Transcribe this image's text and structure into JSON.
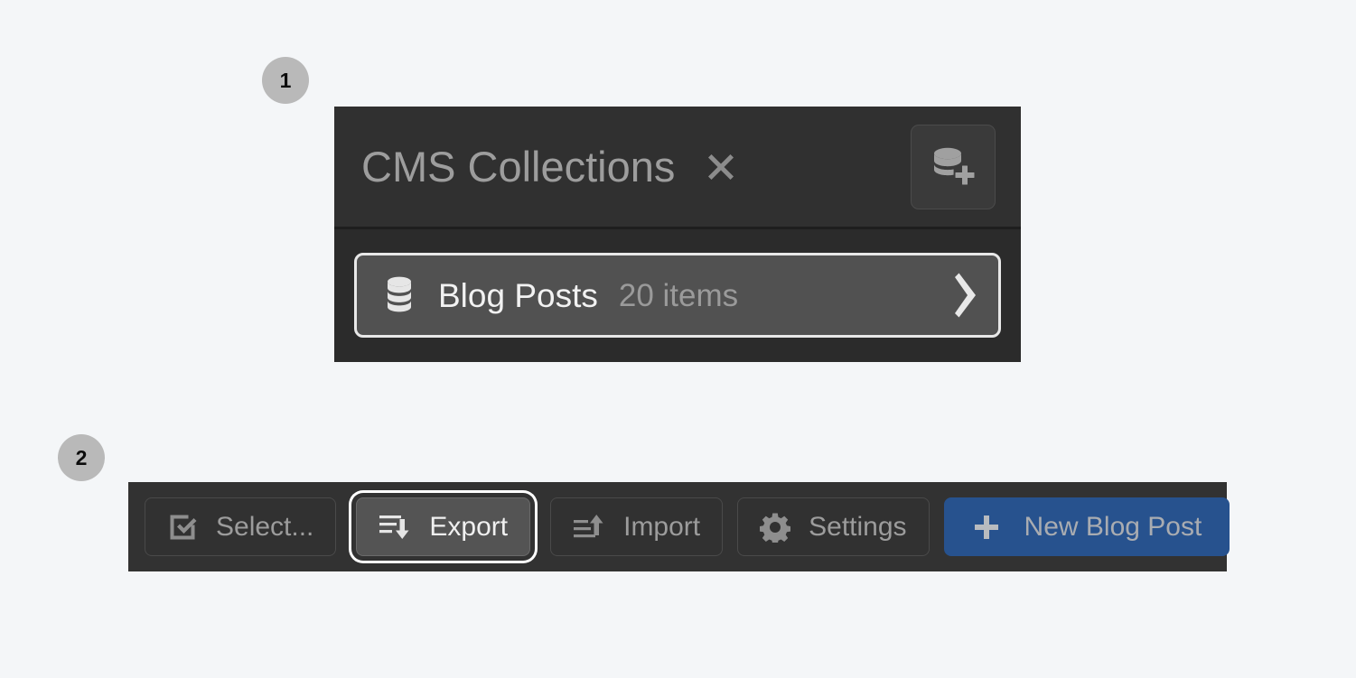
{
  "steps": [
    {
      "id": "1",
      "label": "1"
    },
    {
      "id": "2",
      "label": "2"
    }
  ],
  "cms_panel": {
    "title": "CMS Collections",
    "close_icon": "close-icon",
    "add_collection_icon": "database-plus-icon",
    "collections": [
      {
        "icon": "database-icon",
        "name": "Blog Posts",
        "count": "20 items",
        "chevron_icon": "chevron-right-icon"
      }
    ]
  },
  "toolbar": {
    "buttons": [
      {
        "id": "select",
        "label": "Select...",
        "icon": "checkbox-checked-icon",
        "state": "normal"
      },
      {
        "id": "export",
        "label": "Export",
        "icon": "export-icon",
        "state": "focused"
      },
      {
        "id": "import",
        "label": "Import",
        "icon": "import-icon",
        "state": "normal"
      },
      {
        "id": "settings",
        "label": "Settings",
        "icon": "gear-icon",
        "state": "normal"
      },
      {
        "id": "new",
        "label": "New Blog Post",
        "icon": "plus-icon",
        "state": "primary"
      }
    ]
  },
  "colors": {
    "page_background": "#f4f6f8",
    "panel_background": "#2b2b2b",
    "panel_header": "#303030",
    "toolbar_background": "#323232",
    "primary_button": "#27528e",
    "focus_ring": "#ffffff",
    "badge_background": "#b9b9b9",
    "muted_text": "#9c9c9c",
    "bright_text": "#f2f2f2"
  }
}
